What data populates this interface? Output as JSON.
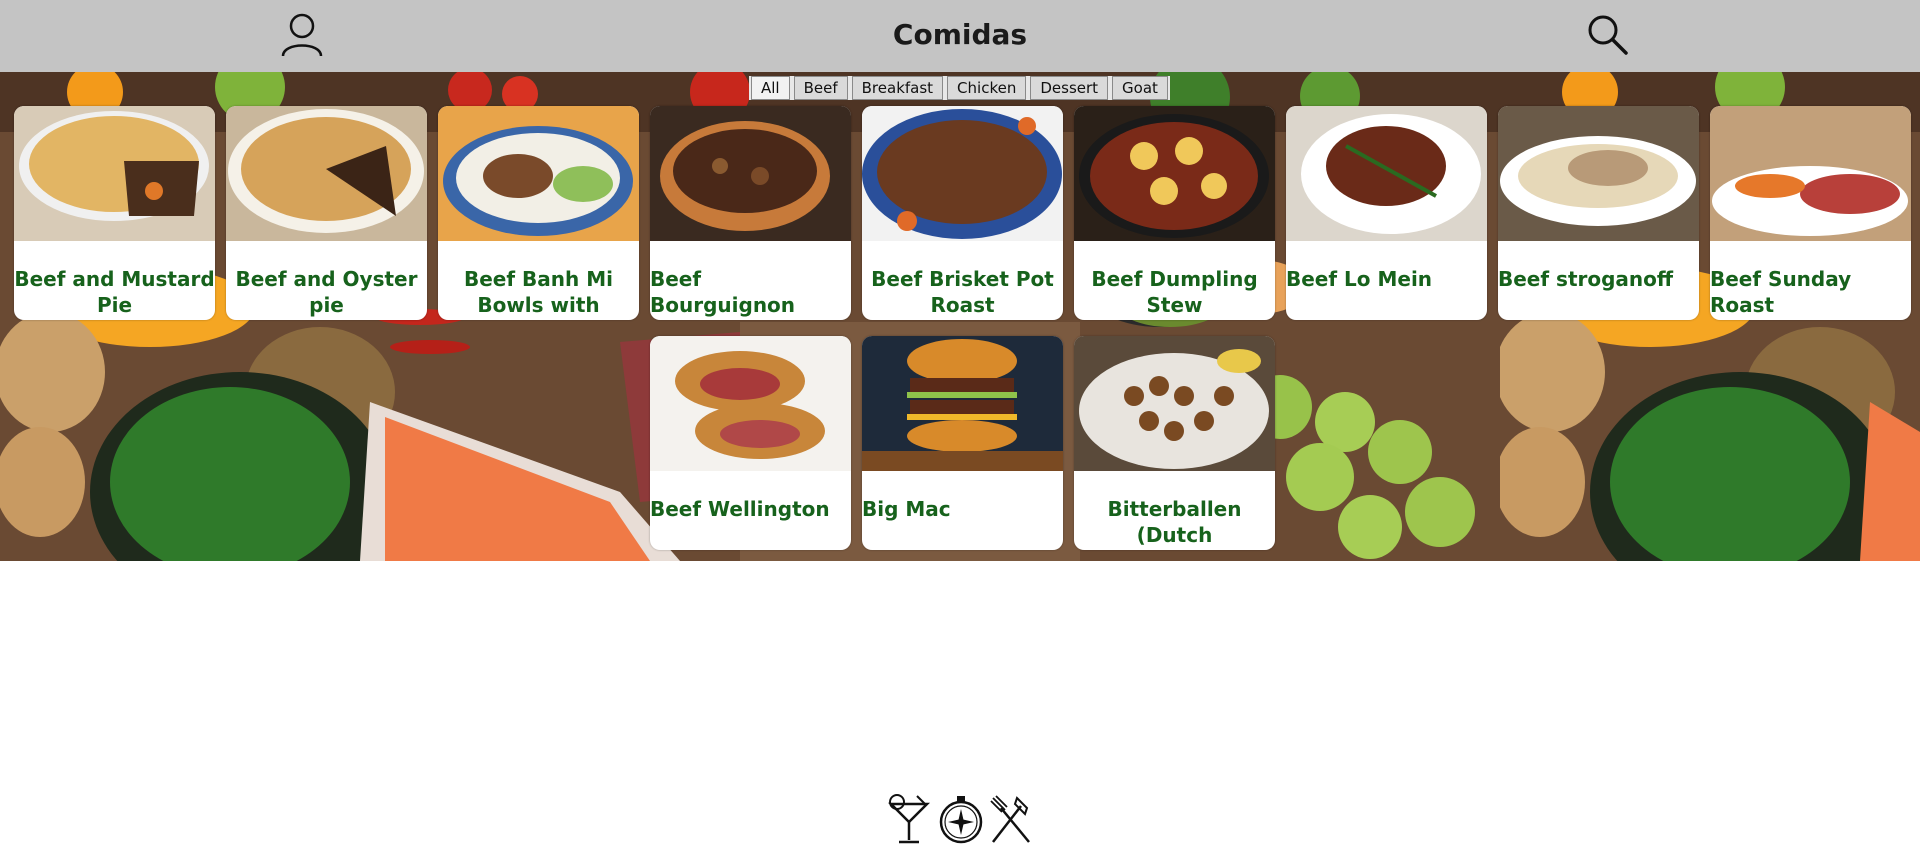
{
  "header": {
    "title": "Comidas",
    "profile_icon": "user-icon",
    "search_icon": "search-icon"
  },
  "filters": [
    {
      "label": "All",
      "active": true
    },
    {
      "label": "Beef",
      "active": false
    },
    {
      "label": "Breakfast",
      "active": false
    },
    {
      "label": "Chicken",
      "active": false
    },
    {
      "label": "Dessert",
      "active": false
    },
    {
      "label": "Goat",
      "active": false
    }
  ],
  "meals": [
    {
      "name": "Beef and Mustard Pie",
      "image": "meal-photo"
    },
    {
      "name": "Beef and Oyster pie",
      "image": "meal-photo"
    },
    {
      "name": "Beef Banh Mi Bowls with",
      "image": "meal-photo"
    },
    {
      "name": "Beef Bourguignon",
      "image": "meal-photo"
    },
    {
      "name": "Beef Brisket Pot Roast",
      "image": "meal-photo"
    },
    {
      "name": "Beef Dumpling Stew",
      "image": "meal-photo"
    },
    {
      "name": "Beef Lo Mein",
      "image": "meal-photo"
    },
    {
      "name": "Beef stroganoff",
      "image": "meal-photo"
    },
    {
      "name": "Beef Sunday Roast",
      "image": "meal-photo"
    },
    {
      "name": "Beef Wellington",
      "image": "meal-photo"
    },
    {
      "name": "Big Mac",
      "image": "meal-photo"
    },
    {
      "name": "Bitterballen (Dutch meatballs)",
      "image": "meal-photo"
    }
  ],
  "footer": {
    "icons": [
      "cocktail-icon",
      "compass-icon",
      "fork-knife-icon"
    ]
  },
  "colors": {
    "header_bg": "#c4c4c4",
    "card_title": "#17621c",
    "card_bg": "#ffffff"
  }
}
